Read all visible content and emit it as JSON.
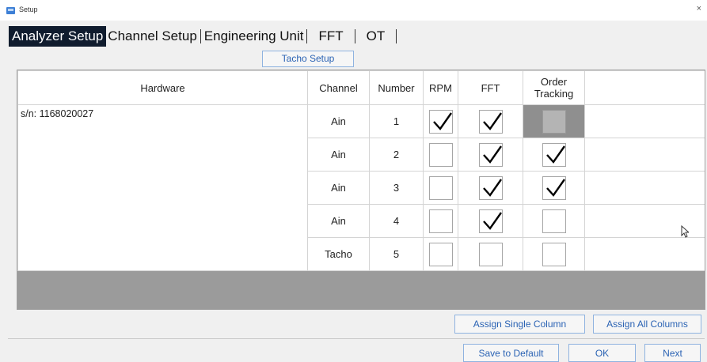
{
  "window": {
    "title": "Setup",
    "close_glyph": "×"
  },
  "tabs": [
    {
      "label": "Analyzer Setup",
      "active": true
    },
    {
      "label": "Channel Setup",
      "active": false
    },
    {
      "label": "Engineering Unit",
      "active": false
    },
    {
      "label": "FFT",
      "active": false
    },
    {
      "label": "OT",
      "active": false
    }
  ],
  "tacho_setup_label": "Tacho Setup",
  "table": {
    "headers": {
      "hardware": "Hardware",
      "channel": "Channel",
      "number": "Number",
      "rpm": "RPM",
      "fft": "FFT",
      "order_tracking_line1": "Order",
      "order_tracking_line2": "Tracking"
    },
    "hardware_serial": "s/n: 1168020027",
    "rows": [
      {
        "channel": "Ain",
        "number": "1",
        "rpm": true,
        "fft": true,
        "order_tracking": false,
        "ot_disabled": true
      },
      {
        "channel": "Ain",
        "number": "2",
        "rpm": false,
        "fft": true,
        "order_tracking": true,
        "ot_disabled": false
      },
      {
        "channel": "Ain",
        "number": "3",
        "rpm": false,
        "fft": true,
        "order_tracking": true,
        "ot_disabled": false
      },
      {
        "channel": "Ain",
        "number": "4",
        "rpm": false,
        "fft": true,
        "order_tracking": false,
        "ot_disabled": false
      },
      {
        "channel": "Tacho",
        "number": "5",
        "rpm": false,
        "fft": false,
        "order_tracking": false,
        "ot_disabled": false
      }
    ]
  },
  "buttons": {
    "assign_single": "Assign Single Column",
    "assign_all": "Assign All Columns",
    "save_default": "Save to Default",
    "ok": "OK",
    "next": "Next"
  },
  "colors": {
    "active_tab": "#101c2e",
    "button_text": "#2b63b4",
    "grey_band": "#9b9b9b"
  },
  "icons": {
    "app": "setup-app-icon",
    "check": "checkmark-icon",
    "cursor": "mouse-pointer-icon"
  }
}
